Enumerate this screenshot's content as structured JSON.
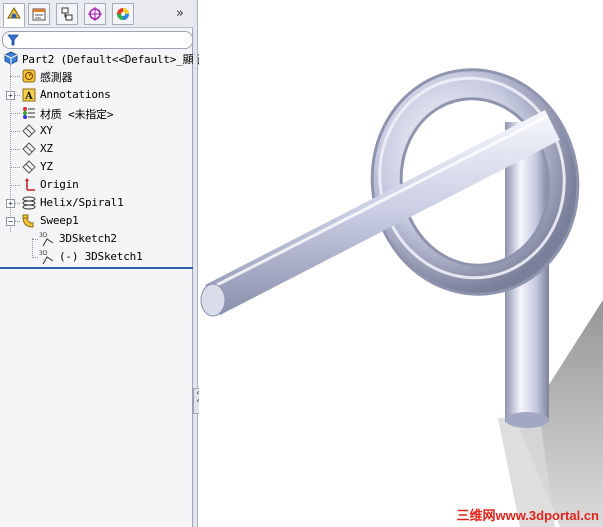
{
  "tabs": [
    {
      "name": "featuremanager",
      "active": true
    },
    {
      "name": "propertymanager",
      "active": false
    },
    {
      "name": "configurationmanager",
      "active": false
    },
    {
      "name": "dimxpertmanager",
      "active": false
    },
    {
      "name": "displaymanager",
      "active": false
    }
  ],
  "tabs_more": "»",
  "filter": {
    "icon": "filter-icon"
  },
  "tree": {
    "root": "Part2  (Default<<Default>_顯示",
    "items": [
      {
        "label": "感測器"
      },
      {
        "label": "Annotations",
        "expander": "+"
      },
      {
        "label": "材质 <未指定>"
      },
      {
        "label": "XY"
      },
      {
        "label": "XZ"
      },
      {
        "label": "YZ"
      },
      {
        "label": "Origin"
      },
      {
        "label": "Helix/Spiral1",
        "expander": "+"
      },
      {
        "label": "Sweep1",
        "expander": "−"
      },
      {
        "label": "3DSketch2"
      },
      {
        "label": "(-) 3DSketch1"
      }
    ]
  },
  "colors": {
    "accent": "#2f5fa8",
    "watermark": "#e2231a",
    "model": "#c9cde3"
  },
  "watermark": "三维网www.3dportal.cn"
}
